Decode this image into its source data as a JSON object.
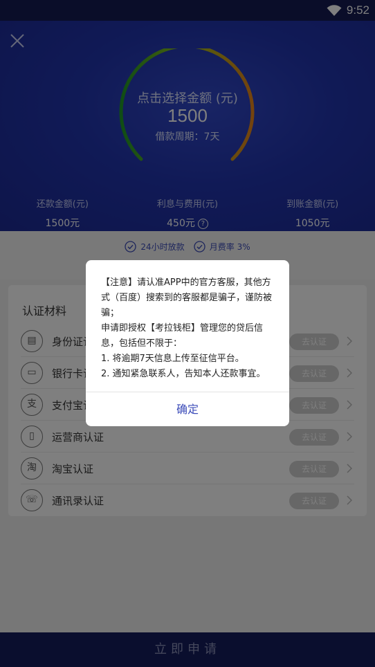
{
  "status_bar": {
    "time": "9:52"
  },
  "hero": {
    "select_title": "点击选择金额 (元)",
    "amount": "1500",
    "period": "借款周期：7天"
  },
  "stats": [
    {
      "label": "还款金额(元)",
      "value": "1500元"
    },
    {
      "label": "利息与费用(元)",
      "value": "450元"
    },
    {
      "label": "到账金额(元)",
      "value": "1050元"
    }
  ],
  "features": [
    {
      "text": "24小时放款"
    },
    {
      "text": "月费率 3%"
    }
  ],
  "auth": {
    "title": "认证材料",
    "items": [
      {
        "label": "身份证认证",
        "button": "去认证",
        "icon": "id-card-icon",
        "glyph": "▤"
      },
      {
        "label": "银行卡认证",
        "button": "去认证",
        "icon": "bank-card-icon",
        "glyph": "▭"
      },
      {
        "label": "支付宝认证",
        "button": "去认证",
        "icon": "alipay-icon",
        "glyph": "支"
      },
      {
        "label": "运营商认证",
        "button": "去认证",
        "icon": "phone-icon",
        "glyph": "▯"
      },
      {
        "label": "淘宝认证",
        "button": "去认证",
        "icon": "taobao-icon",
        "glyph": "淘"
      },
      {
        "label": "通讯录认证",
        "button": "去认证",
        "icon": "contacts-icon",
        "glyph": "☏"
      }
    ]
  },
  "dialog": {
    "line1": "【注意】请认准APP中的官方客服，其他方式（百度）搜索到的客服都是骗子，谨防被骗；",
    "line2": "申请即授权【考拉钱柜】管理您的贷后信息，包括但不限于：",
    "line3": "1. 将逾期7天信息上传至征信平台。",
    "line4": "2. 通知紧急联系人，告知本人还款事宜。",
    "confirm": "确定"
  },
  "footer": {
    "apply": "立即申请"
  },
  "colors": {
    "hero_blue": "#2134ad",
    "accent": "#3c4cb9",
    "footer": "#141c5c"
  }
}
